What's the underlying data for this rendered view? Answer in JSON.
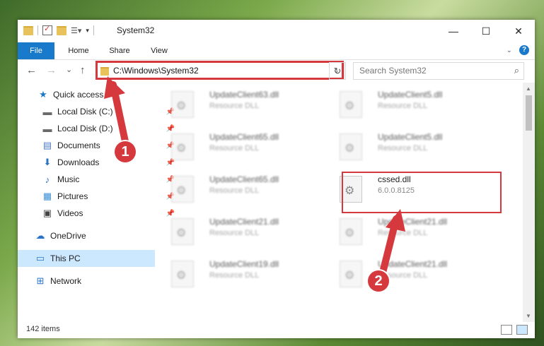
{
  "window": {
    "title": "System32",
    "controls": {
      "minimize": "—",
      "maximize": "☐",
      "close": "✕"
    }
  },
  "ribbon": {
    "tabs": [
      "File",
      "Home",
      "Share",
      "View"
    ],
    "expand_icon": "chevron-down-icon",
    "help_label": "?"
  },
  "nav": {
    "back": "←",
    "forward": "→",
    "recent": "⌄",
    "up": "↑",
    "address": "C:\\Windows\\System32",
    "search_placeholder": "Search System32"
  },
  "sidebar": {
    "items": [
      {
        "label": "Quick access",
        "icon": "star-icon",
        "glyph": "★",
        "color": "#1979ca"
      },
      {
        "label": "Local Disk (C:)",
        "icon": "drive-icon",
        "glyph": "▬",
        "color": "#6a6a6a",
        "pinned": true
      },
      {
        "label": "Local Disk (D:)",
        "icon": "drive-icon",
        "glyph": "▬",
        "color": "#6a6a6a",
        "pinned": true
      },
      {
        "label": "Documents",
        "icon": "documents-icon",
        "glyph": "▤",
        "color": "#4b7bc2",
        "pinned": true
      },
      {
        "label": "Downloads",
        "icon": "download-icon",
        "glyph": "⬇",
        "color": "#2a74c8",
        "pinned": true
      },
      {
        "label": "Music",
        "icon": "music-icon",
        "glyph": "♪",
        "color": "#2a74c8",
        "pinned": true
      },
      {
        "label": "Pictures",
        "icon": "pictures-icon",
        "glyph": "▦",
        "color": "#3b8ed8",
        "pinned": true
      },
      {
        "label": "Videos",
        "icon": "videos-icon",
        "glyph": "▣",
        "color": "#444",
        "pinned": true
      },
      {
        "label": "OneDrive",
        "icon": "cloud-icon",
        "glyph": "☁",
        "color": "#2a74c8"
      },
      {
        "label": "This PC",
        "icon": "computer-icon",
        "glyph": "▭",
        "color": "#2a74c8",
        "selected": true
      },
      {
        "label": "Network",
        "icon": "network-icon",
        "glyph": "⊞",
        "color": "#2a74c8"
      }
    ],
    "pin_glyph": "📌"
  },
  "files": [
    {
      "name": "UpdateClient63.dll",
      "sub": "Resource DLL"
    },
    {
      "name": "UpdateClient5.dll",
      "sub": "Resource DLL"
    },
    {
      "name": "UpdateClient65.dll",
      "sub": "Resource DLL"
    },
    {
      "name": "UpdateClient5.dll",
      "sub": "Resource DLL"
    },
    {
      "name": "UpdateClient65.dll",
      "sub": "Resource DLL"
    },
    {
      "name": "cssed.dll",
      "sub": "6.0.0.8125"
    },
    {
      "name": "UpdateClient21.dll",
      "sub": "Resource DLL"
    },
    {
      "name": "UpdateClient21.dll",
      "sub": "Resource DLL"
    },
    {
      "name": "UpdateClient19.dll",
      "sub": "Resource DLL"
    },
    {
      "name": "UpdateClient21.dll",
      "sub": "Resource DLL"
    }
  ],
  "annotations": {
    "step1": "1",
    "step2": "2",
    "color": "#d6393d"
  },
  "status": {
    "count": "142 items"
  }
}
